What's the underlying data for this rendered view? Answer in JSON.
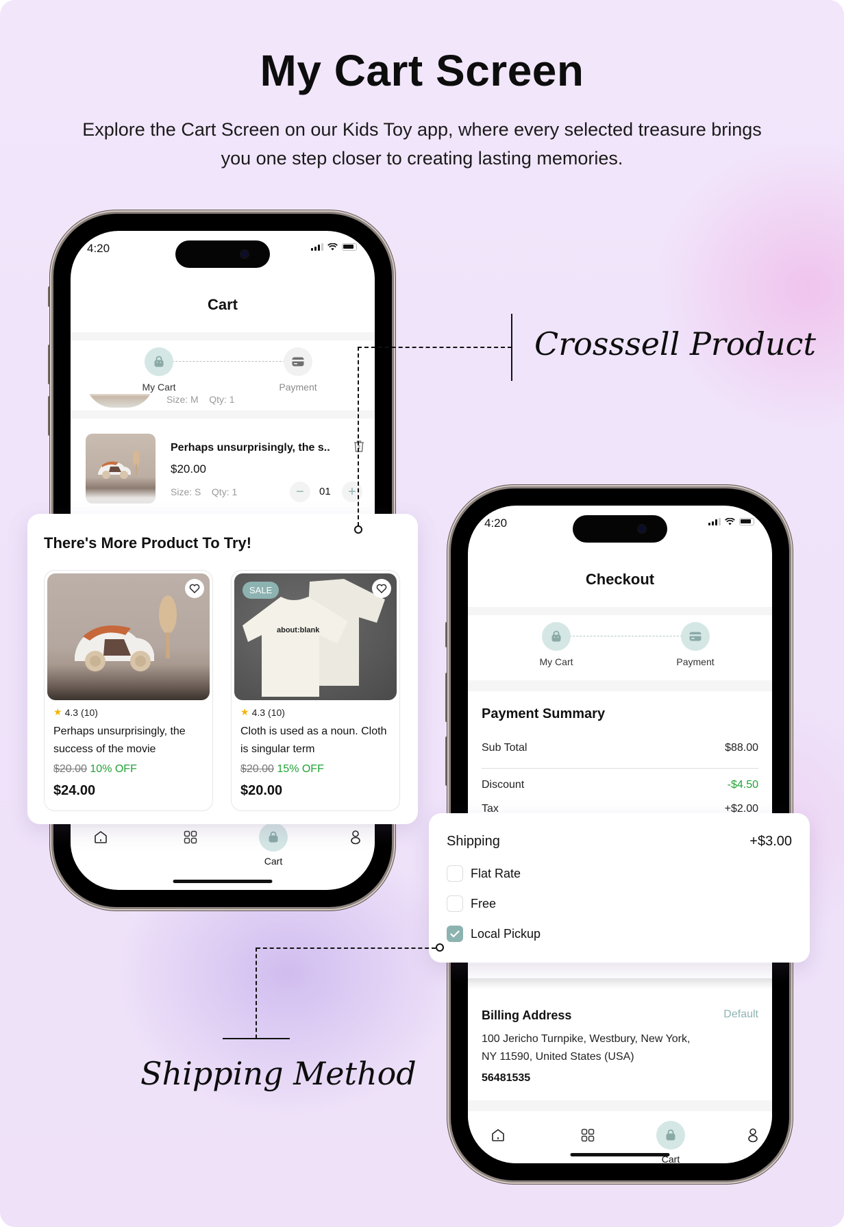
{
  "hero": {
    "title": "My Cart Screen",
    "subtitle": "Explore the Cart Screen on our Kids Toy app, where every selected treasure brings you one step closer to creating lasting memories."
  },
  "annotations": {
    "crosssell": "Crosssell Product",
    "shipping": "Shipping Method"
  },
  "colors": {
    "accent": "#8db3b1",
    "accent_light": "#d4e7e5",
    "discount_green": "#21a336"
  },
  "cart_phone": {
    "status_time": "4:20",
    "title": "Cart",
    "steps": [
      {
        "label": "My Cart",
        "icon": "bag-icon",
        "active": true
      },
      {
        "label": "Payment",
        "icon": "card-icon",
        "active": false
      }
    ],
    "partial_item": {
      "size": "Size: M",
      "qty": "Qty: 1"
    },
    "item": {
      "name": "Perhaps unsurprisingly,  the s..",
      "price": "$20.00",
      "size": "Size: S",
      "qty": "Qty: 1",
      "quantity": "01"
    },
    "tabs": [
      {
        "label": "",
        "icon": "home-icon"
      },
      {
        "label": "",
        "icon": "grid-icon"
      },
      {
        "label": "Cart",
        "icon": "bag-icon",
        "active": true
      },
      {
        "label": "",
        "icon": "user-icon"
      }
    ]
  },
  "crosssell": {
    "heading": "There's  More Product To Try!",
    "products": [
      {
        "name": "Perhaps unsurprisingly,  the success of the movie",
        "rating": "4.3",
        "reviews": "(10)",
        "old_price": "$20.00",
        "discount": "10% OFF",
        "price": "$24.00",
        "badge": ""
      },
      {
        "name": "Cloth is used as a noun. Cloth is singular term",
        "rating": "4.3",
        "reviews": "(10)",
        "old_price": "$20.00",
        "discount": "15% OFF",
        "price": "$20.00",
        "badge": "SALE",
        "shirt_print": "about:blank"
      }
    ]
  },
  "checkout_phone": {
    "status_time": "4:20",
    "title": "Checkout",
    "steps": [
      {
        "label": "My Cart",
        "icon": "bag-icon",
        "active": true
      },
      {
        "label": "Payment",
        "icon": "card-icon",
        "active": true
      }
    ],
    "summary": {
      "heading": "Payment Summary",
      "rows": [
        {
          "label": "Sub Total",
          "value": "$88.00"
        },
        {
          "label": "Discount",
          "value": "-$4.50"
        },
        {
          "label": "Tax",
          "value": "+$2.00"
        }
      ]
    },
    "billing": {
      "heading": "Billing Address",
      "tag": "Default",
      "line1": "100 Jericho Turnpike, Westbury, New York,",
      "line2": "NY 11590, United States (USA)",
      "phone": "56481535"
    },
    "tabs": [
      {
        "label": "",
        "icon": "home-icon"
      },
      {
        "label": "",
        "icon": "grid-icon"
      },
      {
        "label": "Cart",
        "icon": "bag-icon",
        "active": true
      },
      {
        "label": "",
        "icon": "user-icon"
      }
    ]
  },
  "shipping": {
    "label": "Shipping",
    "value": "+$3.00",
    "options": [
      {
        "label": "Flat Rate",
        "checked": false
      },
      {
        "label": "Free",
        "checked": false
      },
      {
        "label": "Local Pickup",
        "checked": true
      }
    ]
  }
}
